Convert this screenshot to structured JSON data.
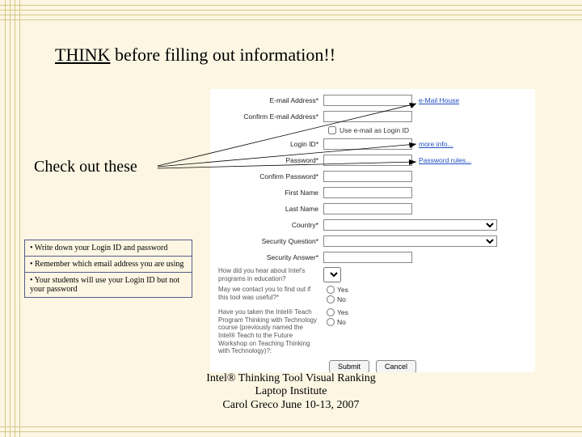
{
  "title": {
    "underlined": "THINK",
    "rest": " before filling out information!!"
  },
  "checkout": "Check out these",
  "notes": [
    "•  Write down your Login ID and password",
    "•  Remember which email address you are using",
    "•  Your students will use your Login ID but not your password"
  ],
  "form": {
    "email_label": "E-mail Address*",
    "confirm_email_label": "Confirm E-mail Address*",
    "email_help": "e-Mail House",
    "use_email_checkbox": "Use e-mail as Login ID",
    "login_id_label": "Login ID*",
    "login_help": "more info...",
    "password_label": "Password*",
    "password_help": "Password rules...",
    "confirm_password_label": "Confirm Password*",
    "first_name_label": "First Name",
    "last_name_label": "Last Name",
    "country_label": "Country*",
    "security_q_label": "Security Question*",
    "security_a_label": "Security Answer*",
    "q1_label": "How did you hear about Intel's programs in education?",
    "q2_label": "May we contact you to find out if this tool was useful?*",
    "q3_label": "Have you taken the Intel® Teach Program Thinking with Technology course (previously named the Intel® Teach to the Future Workshop on Teaching Thinking with Technology)?:",
    "radio_yes": "Yes",
    "radio_no": "No",
    "submit": "Submit",
    "cancel": "Cancel"
  },
  "footer": {
    "line1": "Intel® Thinking Tool Visual Ranking",
    "line2": "Laptop Institute",
    "line3": "Carol Greco June 10-13, 2007"
  }
}
